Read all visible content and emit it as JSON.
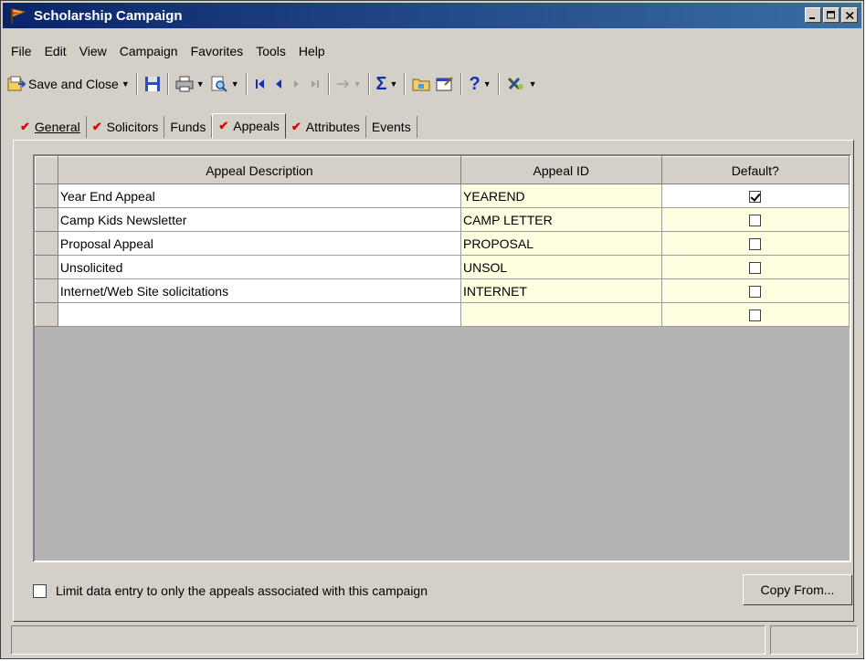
{
  "window": {
    "title": "Scholarship Campaign"
  },
  "menu": [
    "File",
    "Edit",
    "View",
    "Campaign",
    "Favorites",
    "Tools",
    "Help"
  ],
  "toolbar": {
    "save_close_label": "Save and Close"
  },
  "tabs": [
    {
      "label": "General",
      "checked": true
    },
    {
      "label": "Solicitors",
      "checked": true
    },
    {
      "label": "Funds",
      "checked": false
    },
    {
      "label": "Appeals",
      "checked": true,
      "active": true
    },
    {
      "label": "Attributes",
      "checked": true
    },
    {
      "label": "Events",
      "checked": false
    }
  ],
  "grid": {
    "columns": [
      "Appeal Description",
      "Appeal ID",
      "Default?"
    ],
    "rows": [
      {
        "description": "Year End Appeal",
        "id": "YEAREND",
        "default": true
      },
      {
        "description": "Camp Kids Newsletter",
        "id": "CAMP LETTER",
        "default": false
      },
      {
        "description": "Proposal Appeal",
        "id": "PROPOSAL",
        "default": false
      },
      {
        "description": "Unsolicited",
        "id": "UNSOL",
        "default": false
      },
      {
        "description": "Internet/Web Site solicitations",
        "id": "INTERNET",
        "default": false
      },
      {
        "description": "",
        "id": "",
        "default": false
      }
    ]
  },
  "limit_checkbox": {
    "label": "Limit data entry to only the appeals associated with this campaign",
    "checked": false
  },
  "copy_button": {
    "label": "Copy From..."
  },
  "colors": {
    "title_start": "#0a246a",
    "title_end": "#3a6ea5",
    "id_cell": "#fffee0",
    "tab_check": "#e00000"
  }
}
